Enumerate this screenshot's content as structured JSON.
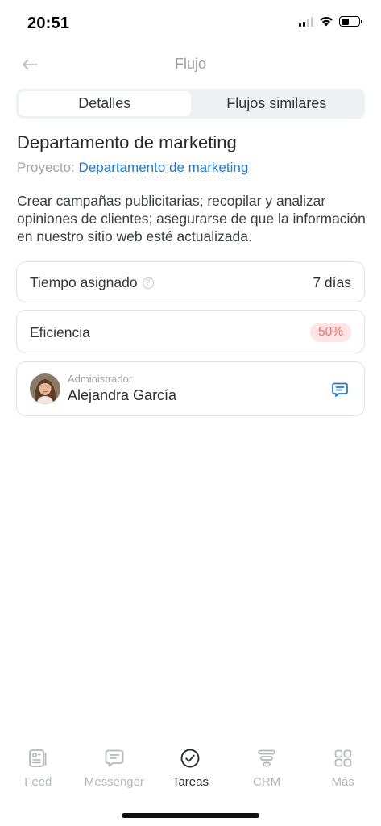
{
  "status": {
    "time": "20:51"
  },
  "nav": {
    "title": "Flujo"
  },
  "tabs": [
    {
      "label": "Detalles",
      "active": true
    },
    {
      "label": "Flujos similares",
      "active": false
    }
  ],
  "flow": {
    "title": "Departamento de marketing",
    "project_label": "Proyecto:",
    "project_link": "Departamento de marketing",
    "description": "Crear campañas publicitarias; recopilar y analizar opiniones de clientes; asegurarse de que la información en nuestro sitio web esté actualizada."
  },
  "time_card": {
    "label": "Tiempo asignado",
    "help_glyph": "?",
    "value": "7 días"
  },
  "efficiency_card": {
    "label": "Eficiencia",
    "value": "50%",
    "badge_color": "#ef6b6b"
  },
  "admin_card": {
    "role": "Administrador",
    "name": "Alejandra García"
  },
  "colors": {
    "accent": "#1f7ad8",
    "muted": "#b4b7bc"
  },
  "bottom_nav": [
    {
      "label": "Feed",
      "icon": "feed-icon",
      "active": false
    },
    {
      "label": "Messenger",
      "icon": "messenger-icon",
      "active": false
    },
    {
      "label": "Tareas",
      "icon": "tasks-check-icon",
      "active": true
    },
    {
      "label": "CRM",
      "icon": "crm-funnel-icon",
      "active": false
    },
    {
      "label": "Más",
      "icon": "grid-more-icon",
      "active": false
    }
  ]
}
